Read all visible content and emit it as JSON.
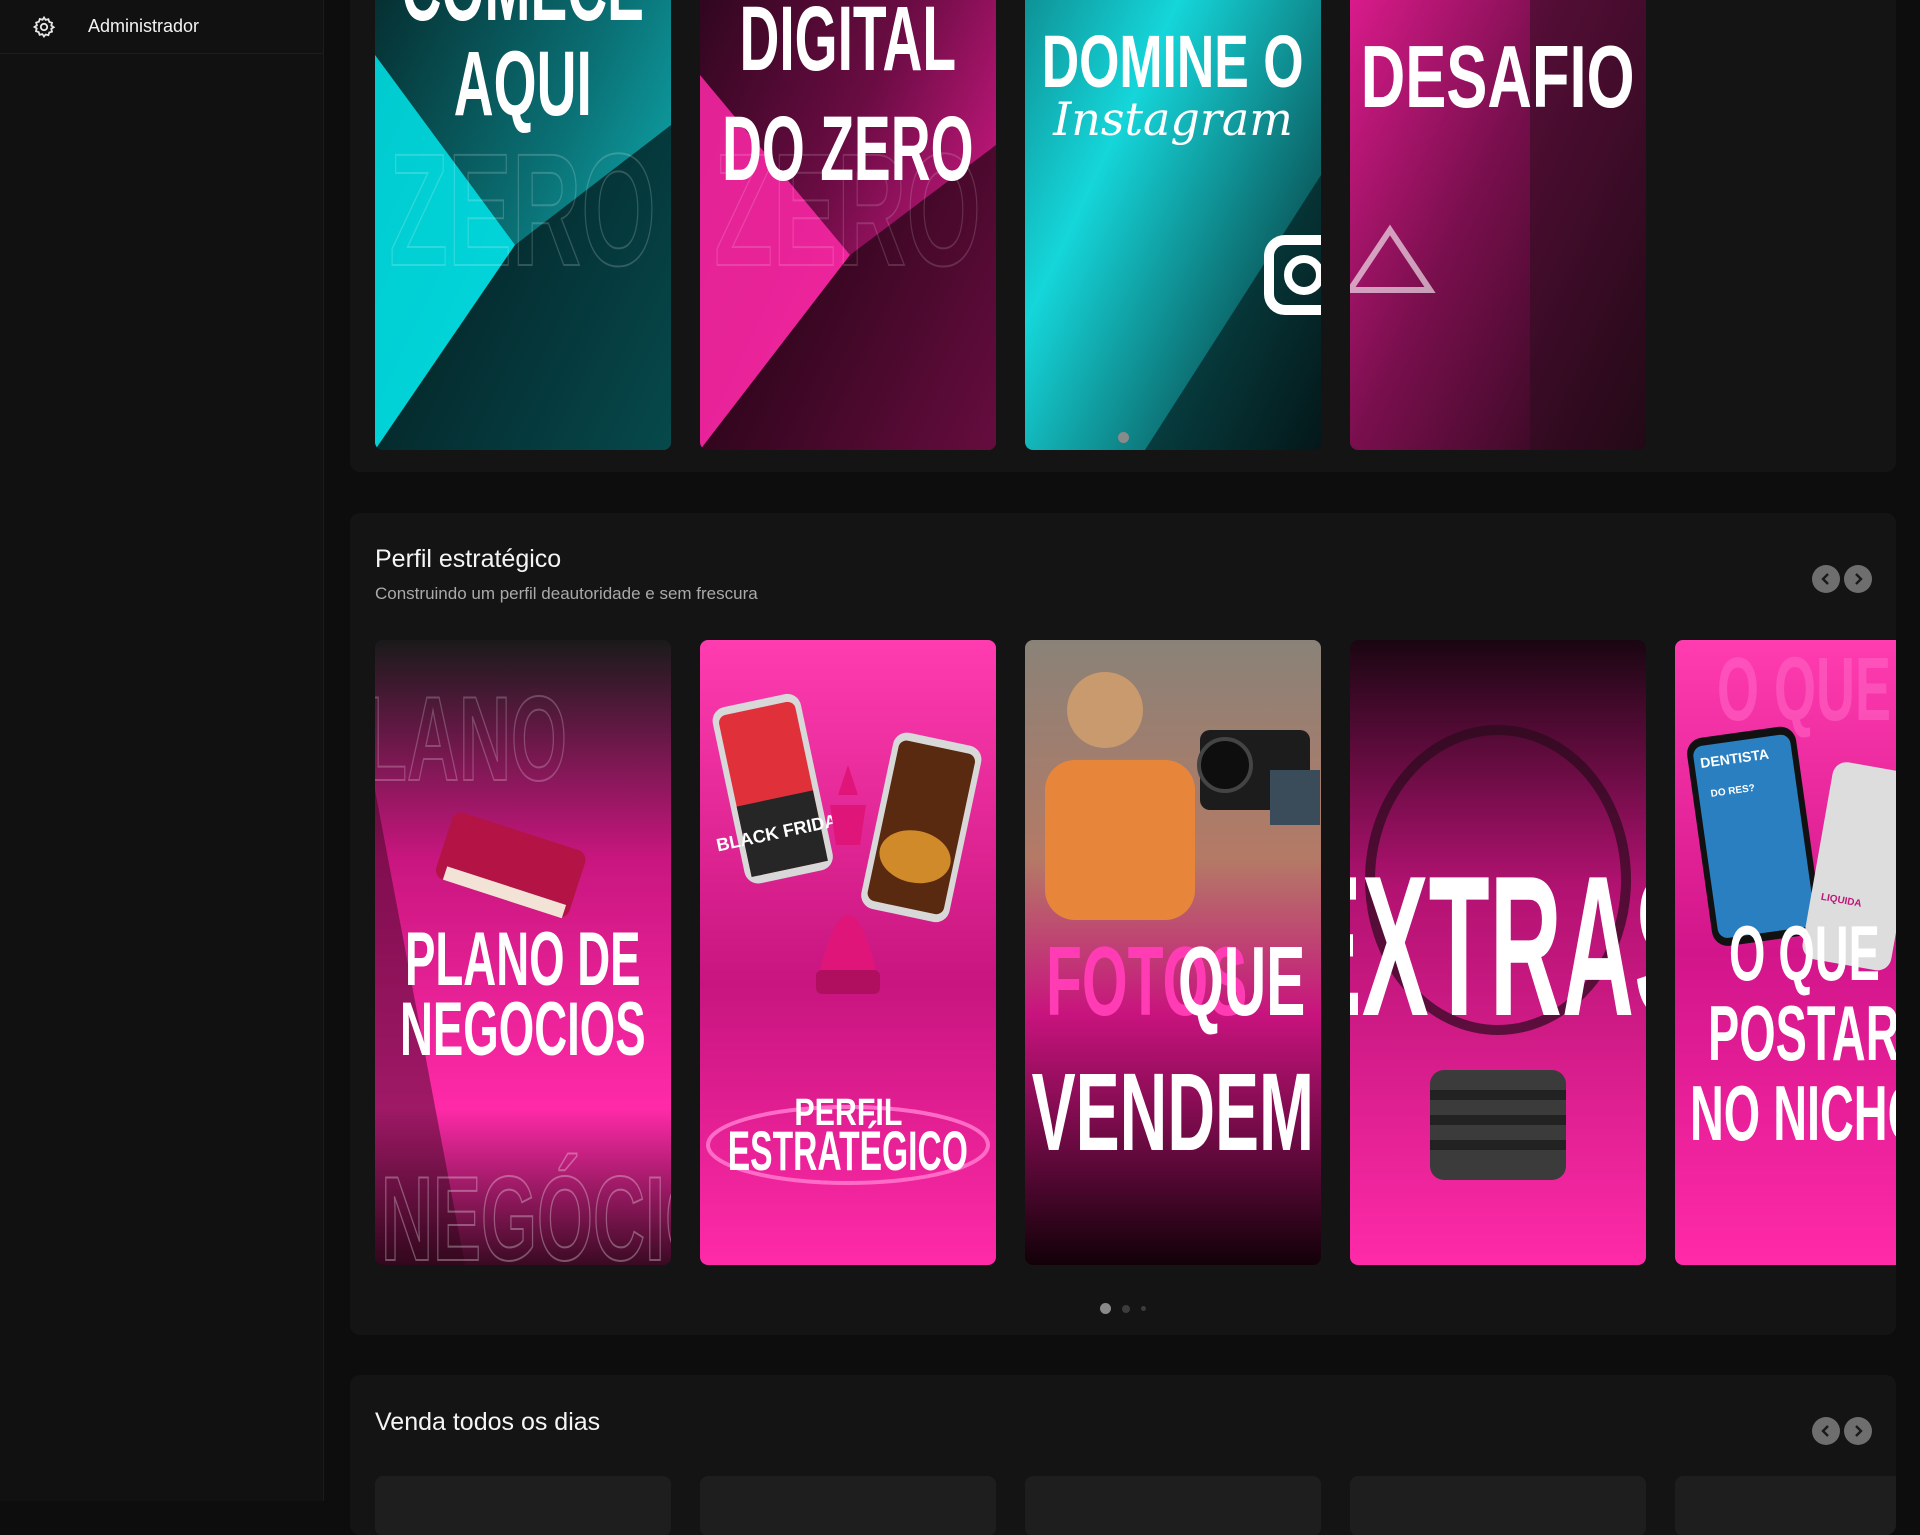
{
  "sidebar": {
    "items": [
      {
        "icon": "gear-icon",
        "label": "Administrador"
      }
    ]
  },
  "sections": [
    {
      "cards": [
        {
          "lines": [
            "COMECE",
            "AQUI"
          ],
          "watermark": "ZERO",
          "accent": "#19e4e8"
        },
        {
          "lines": [
            "DIGITAL",
            "DO ZERO"
          ],
          "watermark": "ZERO",
          "accent": "#ff1fa3"
        },
        {
          "lines": [
            "DOMINE O"
          ],
          "script": "Instagram",
          "accent": "#18dde0"
        },
        {
          "lines": [
            "DESAFIO"
          ],
          "accent": "#ff1fa3"
        }
      ],
      "pages": 1,
      "active_page": 0
    },
    {
      "title": "Perfil estratégico",
      "subtitle": "Construindo um perfil deautoridade e sem frescura",
      "cards": [
        {
          "lines": [
            "PLANO DE",
            "NEGOCIOS"
          ],
          "watermark_top": "PLANO",
          "watermark_bottom": "NEGÓCIOS"
        },
        {
          "lines": [
            "PERFIL",
            "ESTRATÉGICO"
          ],
          "phone_text_1": "BLACK FRIDAY"
        },
        {
          "lines_pink": [
            "FOTOS"
          ],
          "lines": [
            "QUE",
            "VENDEM"
          ]
        },
        {
          "lines": [
            "EXTRAS"
          ]
        },
        {
          "lines": [
            "O QUE",
            "POSTAR",
            "NO NICHO"
          ],
          "watermark": "O QUE POSTAR",
          "phone_label": "DENTISTA",
          "phone_text_2": "DO RES?",
          "phone_text_3": "LIQUIDA"
        }
      ],
      "pages": 3,
      "active_page": 0
    },
    {
      "title": "Venda todos os dias",
      "pages": 0
    }
  ],
  "colors": {
    "pink": "#ff1fa3",
    "cyan": "#19e4e8",
    "panel": "#141414",
    "sidebar": "#111111"
  }
}
